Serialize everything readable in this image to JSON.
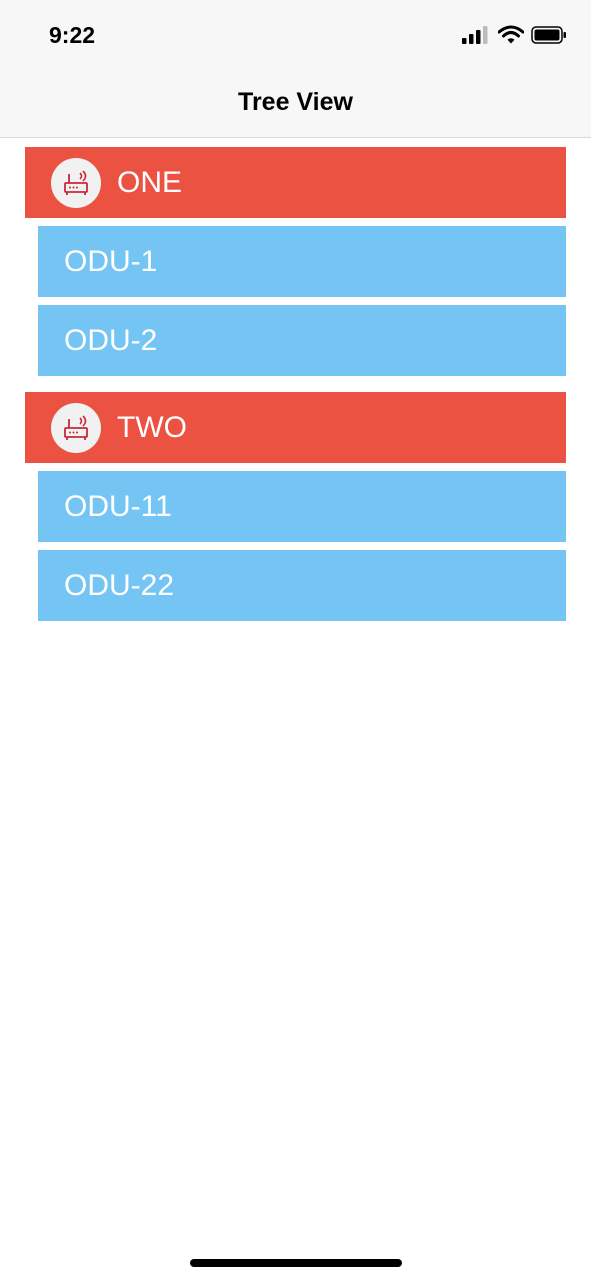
{
  "status_bar": {
    "time": "9:22",
    "icons": [
      "cellular-signal-icon",
      "wifi-icon",
      "battery-icon"
    ]
  },
  "nav_bar": {
    "title": "Tree View"
  },
  "tree": {
    "groups": [
      {
        "label": "ONE",
        "icon": "router-icon",
        "children": [
          {
            "label": "ODU-1"
          },
          {
            "label": "ODU-2"
          }
        ]
      },
      {
        "label": "TWO",
        "icon": "router-icon",
        "children": [
          {
            "label": "ODU-11"
          },
          {
            "label": "ODU-22"
          }
        ]
      }
    ]
  },
  "colors": {
    "group_header": "#ec5242",
    "child_row": "#75c5f4",
    "icon_stroke": "#c8283c",
    "text_on_row": "#ffffff"
  }
}
